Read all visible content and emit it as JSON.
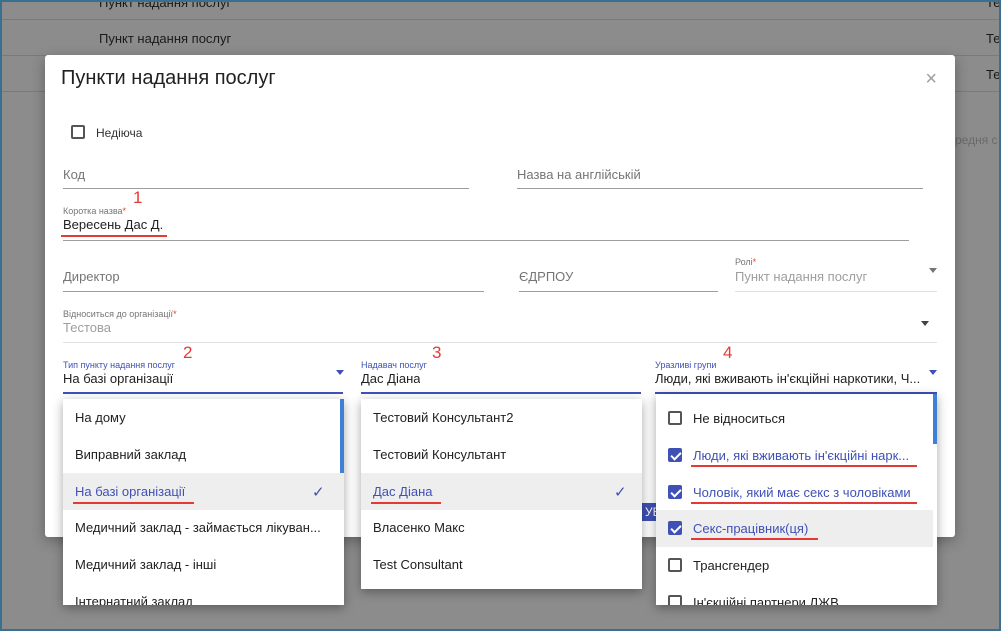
{
  "background": {
    "rows": [
      {
        "col1": "Пункт надання послуг",
        "col2": "Те"
      },
      {
        "col1": "Пункт надання послуг",
        "col2": "Тес"
      },
      {
        "col1": "",
        "col2": "Те"
      }
    ],
    "right_text": "редня с"
  },
  "modal": {
    "title": "Пункти надання послуг",
    "close_icon": "×",
    "inactive_label": "Недіюча",
    "code_label": "Код",
    "english_name_label": "Назва на англійській",
    "short_name_label": "Коротка назва",
    "short_name_value": "Вересень Дас Д.",
    "director_label": "Директор",
    "edrpou_label": "ЄДРПОУ",
    "roles_label": "Ролі",
    "roles_value": "Пункт надання послуг",
    "org_label": "Відноситься до організації",
    "org_value": "Тестова",
    "type_label": "Тип пункту надання послуг",
    "type_value": "На базі організації",
    "provider_label": "Надавач послуг",
    "provider_value": "Дас Діана",
    "vulnerable_label": "Уразливі групи",
    "vulnerable_value": "Люди, які вживають ін'єкційні наркотики, Ч...",
    "required_mark": "*"
  },
  "annotations": [
    "1",
    "2",
    "3",
    "4"
  ],
  "dropdown_type": {
    "items": [
      "На дому",
      "Виправний заклад",
      "На базі організації",
      "Медичний заклад - займається лікуван...",
      "Медичний заклад - інші",
      "Інтернатний заклад"
    ],
    "check": "✓"
  },
  "dropdown_provider": {
    "items": [
      "Тестовий Консультант2",
      "Тестовий Консультант",
      "Дас Діана",
      "Власенко Макс",
      "Test Consultant"
    ],
    "check": "✓",
    "partial_button": "УВА"
  },
  "dropdown_vulnerable": {
    "items": [
      "Не відноситься",
      "Люди, які вживають ін'єкційні нарк...",
      "Чоловік, який має секс з чоловіками",
      "Секс-працівник(ця)",
      "Трансгендер",
      "Ін'єкційні партнери ЛЖВ"
    ]
  },
  "colors": {
    "accent": "#3f51b5",
    "annotation": "#e53935",
    "scroll": "#3f7fd8"
  }
}
